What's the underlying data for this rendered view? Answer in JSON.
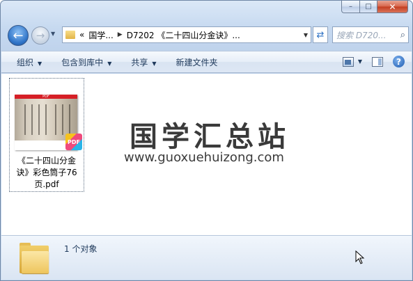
{
  "window": {
    "minimize_label": "–",
    "maximize_label": "□",
    "close_label": "✕"
  },
  "nav": {
    "back_glyph": "←",
    "forward_glyph": "→",
    "history_glyph": "▼",
    "breadcrumb": [
      "国学...",
      "D7202 《二十四山分金诀》..."
    ],
    "breadcrumb_prefix": "«",
    "search_placeholder": "搜索 D720...",
    "search_icon_glyph": "⌕",
    "refresh_glyph": "⇄"
  },
  "commandbar": {
    "items": [
      {
        "label": "组织",
        "has_arrow": true
      },
      {
        "label": "包含到库中",
        "has_arrow": true
      },
      {
        "label": "共享",
        "has_arrow": true
      },
      {
        "label": "新建文件夹",
        "has_arrow": false
      }
    ],
    "arrow_glyph": "▼",
    "help_glyph": "?"
  },
  "files": [
    {
      "name": "《二十四山分金诀》彩色筒子76页.pdf",
      "name_lines": [
        "《二十四山分金",
        "诀》彩色筒子76",
        "页.pdf"
      ],
      "thumb_header": "PDF",
      "badge": "PDF"
    }
  ],
  "watermark": {
    "title": "国学汇总站",
    "url": "www.guoxuehuizong.com"
  },
  "details": {
    "item_count": "1 个对象"
  },
  "colors": {
    "accent": "#2f74c8",
    "pdf_red": "#d61f26",
    "folder": "#eec55d"
  }
}
